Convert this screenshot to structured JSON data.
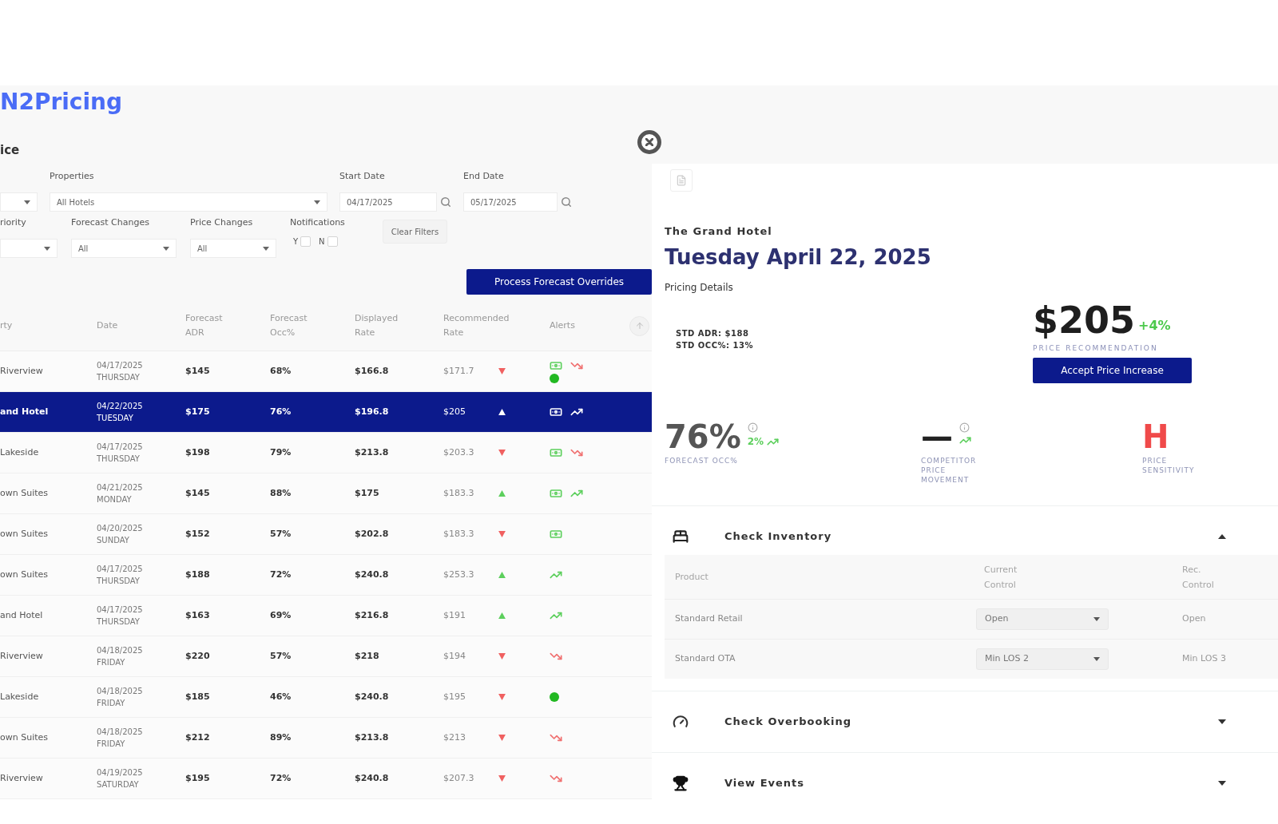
{
  "top": {
    "logo": "N2Pricing",
    "title": "ice"
  },
  "filters": {
    "row_1": [
      {
        "kind": "select"
      },
      {
        "kind": "select",
        "label": "Properties",
        "value": "All Hotels"
      },
      {
        "kind": "date",
        "label": "Start Date",
        "value": "04/17/2025"
      },
      {
        "kind": "date",
        "label": "End Date",
        "value": "05/17/2025"
      }
    ],
    "row_2": [
      {
        "kind": "select",
        "label": "riority"
      },
      {
        "kind": "select",
        "label": "Forecast Changes",
        "value": "All"
      },
      {
        "kind": "select",
        "label": "Price Changes",
        "value": "All"
      },
      {
        "kind": "checks",
        "label": "Notifications",
        "options": [
          {
            "label": "Y",
            "checked": false
          },
          {
            "label": "N",
            "checked": false
          }
        ]
      },
      {
        "kind": "button",
        "label": "Clear Filters"
      }
    ]
  },
  "process_button": "Process Forecast Overrides",
  "table": {
    "columns": [
      "rty",
      "Date",
      "Forecast ADR",
      "Forecast Occ%",
      "Displayed Rate",
      "Recommended Rate",
      "Alerts"
    ],
    "rows": [
      {
        "property": "Riverview",
        "date": "04/17/2025",
        "weekday": "THURSDAY",
        "forecast_adr": "$145",
        "forecast_occ": "68%",
        "displayed_rate": "$166.8",
        "recommended_rate": "$171.7",
        "rising": false,
        "alerts": [
          {
            "kind": "bill"
          },
          {
            "kind": "trend-down"
          },
          {
            "kind": "dot"
          }
        ],
        "selected": false
      },
      {
        "property": "and Hotel",
        "date": "04/22/2025",
        "weekday": "TUESDAY",
        "forecast_adr": "$175",
        "forecast_occ": "76%",
        "displayed_rate": "$196.8",
        "recommended_rate": "$205",
        "rising": true,
        "alerts": [
          {
            "kind": "bill"
          },
          {
            "kind": "trend-up"
          }
        ],
        "selected": true
      },
      {
        "property": "Lakeside",
        "date": "04/17/2025",
        "weekday": "THURSDAY",
        "forecast_adr": "$198",
        "forecast_occ": "79%",
        "displayed_rate": "$213.8",
        "recommended_rate": "$203.3",
        "rising": false,
        "alerts": [
          {
            "kind": "bill"
          },
          {
            "kind": "trend-down"
          }
        ],
        "selected": false
      },
      {
        "property": "own Suites",
        "date": "04/21/2025",
        "weekday": "MONDAY",
        "forecast_adr": "$145",
        "forecast_occ": "88%",
        "displayed_rate": "$175",
        "recommended_rate": "$183.3",
        "rising": true,
        "alerts": [
          {
            "kind": "bill"
          },
          {
            "kind": "trend-up"
          }
        ],
        "selected": false
      },
      {
        "property": "own Suites",
        "date": "04/20/2025",
        "weekday": "SUNDAY",
        "forecast_adr": "$152",
        "forecast_occ": "57%",
        "displayed_rate": "$202.8",
        "recommended_rate": "$183.3",
        "rising": false,
        "alerts": [
          {
            "kind": "bill"
          }
        ],
        "selected": false
      },
      {
        "property": "own Suites",
        "date": "04/17/2025",
        "weekday": "THURSDAY",
        "forecast_adr": "$188",
        "forecast_occ": "72%",
        "displayed_rate": "$240.8",
        "recommended_rate": "$253.3",
        "rising": true,
        "alerts": [
          {
            "kind": "trend-up"
          }
        ],
        "selected": false
      },
      {
        "property": "and Hotel",
        "date": "04/17/2025",
        "weekday": "THURSDAY",
        "forecast_adr": "$163",
        "forecast_occ": "69%",
        "displayed_rate": "$216.8",
        "recommended_rate": "$191",
        "rising": true,
        "alerts": [
          {
            "kind": "trend-up"
          }
        ],
        "selected": false
      },
      {
        "property": "Riverview",
        "date": "04/18/2025",
        "weekday": "FRIDAY",
        "forecast_adr": "$220",
        "forecast_occ": "57%",
        "displayed_rate": "$218",
        "recommended_rate": "$194",
        "rising": false,
        "alerts": [
          {
            "kind": "trend-down"
          }
        ],
        "selected": false
      },
      {
        "property": "Lakeside",
        "date": "04/18/2025",
        "weekday": "FRIDAY",
        "forecast_adr": "$185",
        "forecast_occ": "46%",
        "displayed_rate": "$240.8",
        "recommended_rate": "$195",
        "rising": false,
        "alerts": [
          {
            "kind": "dot"
          }
        ],
        "selected": false
      },
      {
        "property": "own Suites",
        "date": "04/18/2025",
        "weekday": "FRIDAY",
        "forecast_adr": "$212",
        "forecast_occ": "89%",
        "displayed_rate": "$213.8",
        "recommended_rate": "$213",
        "rising": false,
        "alerts": [
          {
            "kind": "trend-down"
          }
        ],
        "selected": false
      },
      {
        "property": "Riverview",
        "date": "04/19/2025",
        "weekday": "SATURDAY",
        "forecast_adr": "$195",
        "forecast_occ": "72%",
        "displayed_rate": "$240.8",
        "recommended_rate": "$207.3",
        "rising": false,
        "alerts": [
          {
            "kind": "trend-down"
          }
        ],
        "selected": false
      }
    ]
  },
  "detail": {
    "property": "The Grand Hotel",
    "date": "Tuesday April 22, 2025",
    "section": "Pricing Details",
    "stats": [
      "STD ADR: $188",
      "STD OCC%: 13%"
    ],
    "price": "$205",
    "change": "+4%",
    "price_label": "PRICE RECOMMENDATION",
    "accept_button": "Accept Price Increase",
    "metrics": [
      {
        "kind": "trend",
        "value": "76%",
        "delta": "2%",
        "rising": true,
        "label": "FORECAST OCC%",
        "color": "#555555"
      },
      {
        "kind": "trend",
        "value": "—",
        "rising": true,
        "label": "COMPETITOR PRICE MOVEMENT",
        "color": "#222222"
      },
      {
        "kind": "grade",
        "value": "H",
        "label": "PRICE SENSITIVITY",
        "color": "#f04a4a"
      }
    ],
    "sections": [
      {
        "title": "Check Inventory",
        "expanded": true,
        "table": {
          "columns": [
            "Product",
            "Current Control",
            "Rec. Control"
          ],
          "rows": [
            {
              "product": "Standard Retail",
              "current": "Open",
              "recommended": "Open"
            },
            {
              "product": "Standard OTA",
              "current": "Min LOS 2",
              "recommended": "Min LOS 3"
            }
          ]
        }
      },
      {
        "title": "Check Overbooking",
        "expanded": false
      },
      {
        "title": "View Events",
        "expanded": false
      }
    ]
  }
}
